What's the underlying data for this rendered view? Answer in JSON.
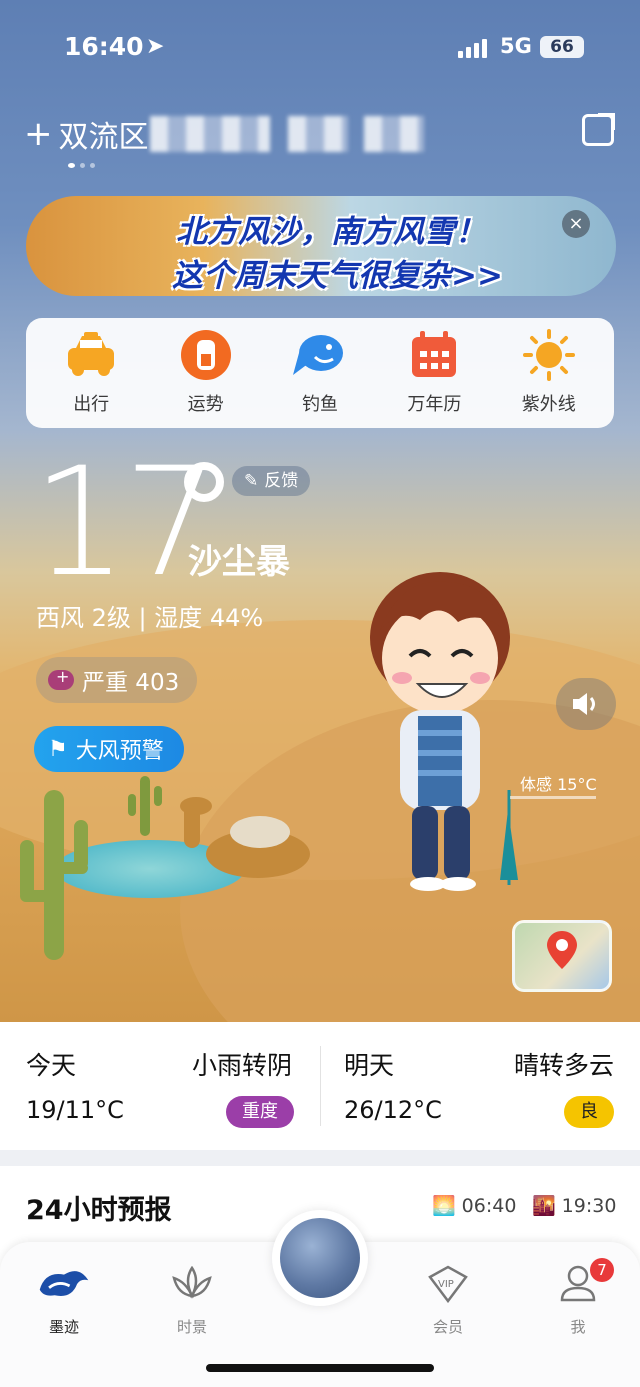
{
  "status_bar": {
    "time": "16:40",
    "network": "5G",
    "battery": "66"
  },
  "location": {
    "plus": "+",
    "name": "双流区"
  },
  "banner": {
    "line1": "北方风沙，南方风雪！",
    "line2": "这个周末天气很复杂>>",
    "close": "×"
  },
  "tools": [
    {
      "label": "出行",
      "icon": "taxi-icon",
      "color": "#f6a623"
    },
    {
      "label": "运势",
      "icon": "fortune-icon",
      "color": "#f26a21"
    },
    {
      "label": "钓鱼",
      "icon": "fish-icon",
      "color": "#2f8ae8"
    },
    {
      "label": "万年历",
      "icon": "calendar-icon",
      "color": "#f05b3a"
    },
    {
      "label": "紫外线",
      "icon": "sun-icon",
      "color": "#f5a623"
    }
  ],
  "current": {
    "temperature": "17",
    "feedback_label": "反馈",
    "condition": "沙尘暴",
    "wind_humidity": "西风 2级 | 湿度 44%",
    "aqi_label": "严重 403",
    "warning_label": "大风预警",
    "feels_like": "体感 15°C"
  },
  "forecast": {
    "today": {
      "day": "今天",
      "desc": "小雨转阴",
      "range": "19/11°C",
      "aqi": "重度",
      "aqi_color": "#9b3ea8"
    },
    "tomorrow": {
      "day": "明天",
      "desc": "晴转多云",
      "range": "26/12°C",
      "aqi": "良",
      "aqi_color": "#f5c400"
    }
  },
  "hourly": {
    "title": "24小时预报",
    "sunrise": "06:40",
    "sunset": "19:30"
  },
  "tabs": [
    {
      "label": "墨迹",
      "icon": "moji-icon"
    },
    {
      "label": "时景",
      "icon": "lotus-icon"
    },
    {
      "label": "会员",
      "icon": "vip-icon"
    },
    {
      "label": "我",
      "icon": "user-icon"
    }
  ],
  "notifications": {
    "me_badge": "7"
  }
}
